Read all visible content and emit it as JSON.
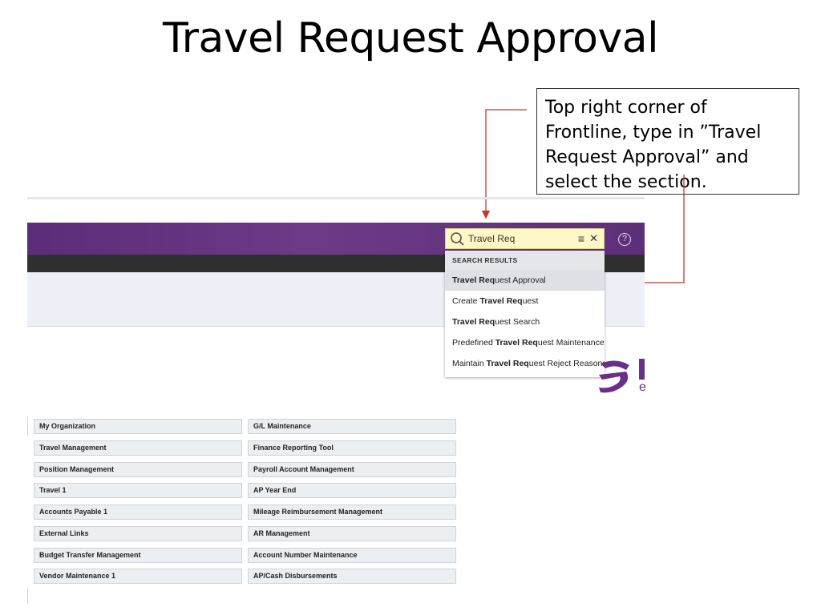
{
  "slide": {
    "title": "Travel Request Approval",
    "callout": "Top right corner of Frontline, type in ”Travel Request Approval” and select the section."
  },
  "search": {
    "value": "Travel Req",
    "icon": "search-icon"
  },
  "results": {
    "header": "SEARCH RESULTS",
    "items": [
      {
        "pre": "",
        "bold": "Travel Req",
        "post": "uest Approval",
        "highlighted": true
      },
      {
        "pre": "Create ",
        "bold": "Travel Req",
        "post": "uest",
        "highlighted": false
      },
      {
        "pre": "",
        "bold": "Travel Req",
        "post": "uest Search",
        "highlighted": false
      },
      {
        "pre": "Predefined ",
        "bold": "Travel Req",
        "post": "uest Maintenance",
        "highlighted": false
      },
      {
        "pre": "Maintain ",
        "bold": "Travel Req",
        "post": "uest Reject Reasons",
        "highlighted": false
      }
    ]
  },
  "menu": {
    "left": [
      "My Organization",
      "Travel Management",
      "Position Management",
      "Travel 1",
      "Accounts Payable 1",
      "External Links",
      "Budget Transfer Management",
      "Vendor Maintenance 1"
    ],
    "right": [
      "G/L Maintenance",
      "Finance Reporting Tool",
      "Payroll Account Management",
      "AP Year End",
      "Mileage Reimbursement Management",
      "AR Management",
      "Account Number Maintenance",
      "AP/Cash Disbursements"
    ]
  },
  "colors": {
    "header_purple": "#5b2d78",
    "arrow_red": "#c0392b",
    "search_yellow": "#fdf8c6",
    "brand": "#6a2f86"
  }
}
